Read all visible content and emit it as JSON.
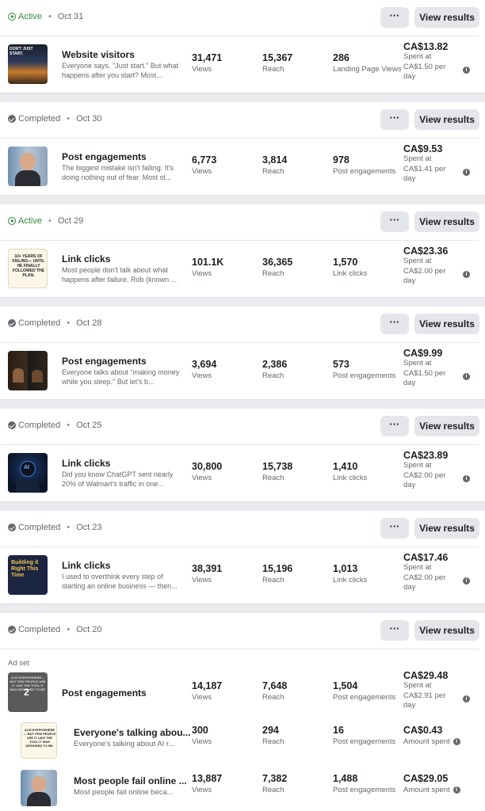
{
  "common": {
    "more_label": "···",
    "view_label": "View results",
    "views": "Views",
    "reach": "Reach",
    "spent_at": "Spent at",
    "per_day": "per day",
    "amount_spent": "Amount spent",
    "info": "i"
  },
  "cards": [
    {
      "status": "Active",
      "date": "Oct 31",
      "title": "Website visitors",
      "desc": "Everyone says, \"Just start.\" But what happens after you start? Most...",
      "views": "31,471",
      "reach": "15,367",
      "result": "286",
      "result_label": "Landing Page Views",
      "spent": "CA$13.82",
      "rate": "CA$1.50"
    },
    {
      "status": "Completed",
      "date": "Oct 30",
      "title": "Post engagements",
      "desc": "The biggest mistake isn't failing. It's doing nothing out of fear. Most st...",
      "views": "6,773",
      "reach": "3,814",
      "result": "978",
      "result_label": "Post engagements",
      "spent": "CA$9.53",
      "rate": "CA$1.41"
    },
    {
      "status": "Active",
      "date": "Oct 29",
      "title": "Link clicks",
      "desc": "Most people don't talk about what happens after failure. Rob (known ...",
      "views": "101.1K",
      "reach": "36,365",
      "result": "1,570",
      "result_label": "Link clicks",
      "spent": "CA$23.36",
      "rate": "CA$2.00"
    },
    {
      "status": "Completed",
      "date": "Oct 28",
      "title": "Post engagements",
      "desc": "Everyone talks about \"making money while you sleep.\" But let's b...",
      "views": "3,694",
      "reach": "2,386",
      "result": "573",
      "result_label": "Post engagements",
      "spent": "CA$9.99",
      "rate": "CA$1.50"
    },
    {
      "status": "Completed",
      "date": "Oct 25",
      "title": "Link clicks",
      "desc": "Did you know ChatGPT sent nearly 20% of Walmart's traffic in one...",
      "views": "30,800",
      "reach": "15,738",
      "result": "1,410",
      "result_label": "Link clicks",
      "spent": "CA$23.89",
      "rate": "CA$2.00"
    },
    {
      "status": "Completed",
      "date": "Oct 23",
      "title": "Link clicks",
      "desc": "I used to overthink every step of starting an online business — then...",
      "views": "38,391",
      "reach": "15,196",
      "result": "1,013",
      "result_label": "Link clicks",
      "spent": "CA$17.46",
      "rate": "CA$2.00"
    }
  ],
  "last": {
    "status": "Completed",
    "date": "Oct 20",
    "adset_label": "Ad set",
    "badge": "2",
    "title": "Post engagements",
    "views": "14,187",
    "reach": "7,648",
    "result": "1,504",
    "result_label": "Post engagements",
    "spent": "CA$29.48",
    "rate": "CA$2.91",
    "ads": [
      {
        "title": "Everyone's talking abou...",
        "desc": "Everyone's talking about AI r...",
        "views": "300",
        "reach": "294",
        "result": "16",
        "result_label": "Post engagements",
        "spent": "CA$0.43"
      },
      {
        "title": "Most people fail online ...",
        "desc": "Most people fail online beca...",
        "views": "13,887",
        "reach": "7,382",
        "result": "1,488",
        "result_label": "Post engagements",
        "spent": "CA$29.05"
      }
    ]
  },
  "thumb_text": {
    "t0": "DON'T JUST START.",
    "t2": "10+ YEARS OF FAILING— UNTIL HE FINALLY FOLLOWED THE PLAN.",
    "t4": "AI",
    "t5": "Building it Right This Time",
    "t6": "AI IS EVERYWHERE— BUT FEW PEOPLE USE IT LIKE THE TOOL IT WAS DESIGNED TO BE.",
    "t7": "AI IS EVERYWHERE— BUT FEW PEOPLE USE IT LIKE THE TOOL IT WAS DESIGNED TO BE."
  },
  "colors": {
    "active": "#2e8b3a",
    "completed": "#65676b",
    "button_bg": "#e4e6eb"
  }
}
